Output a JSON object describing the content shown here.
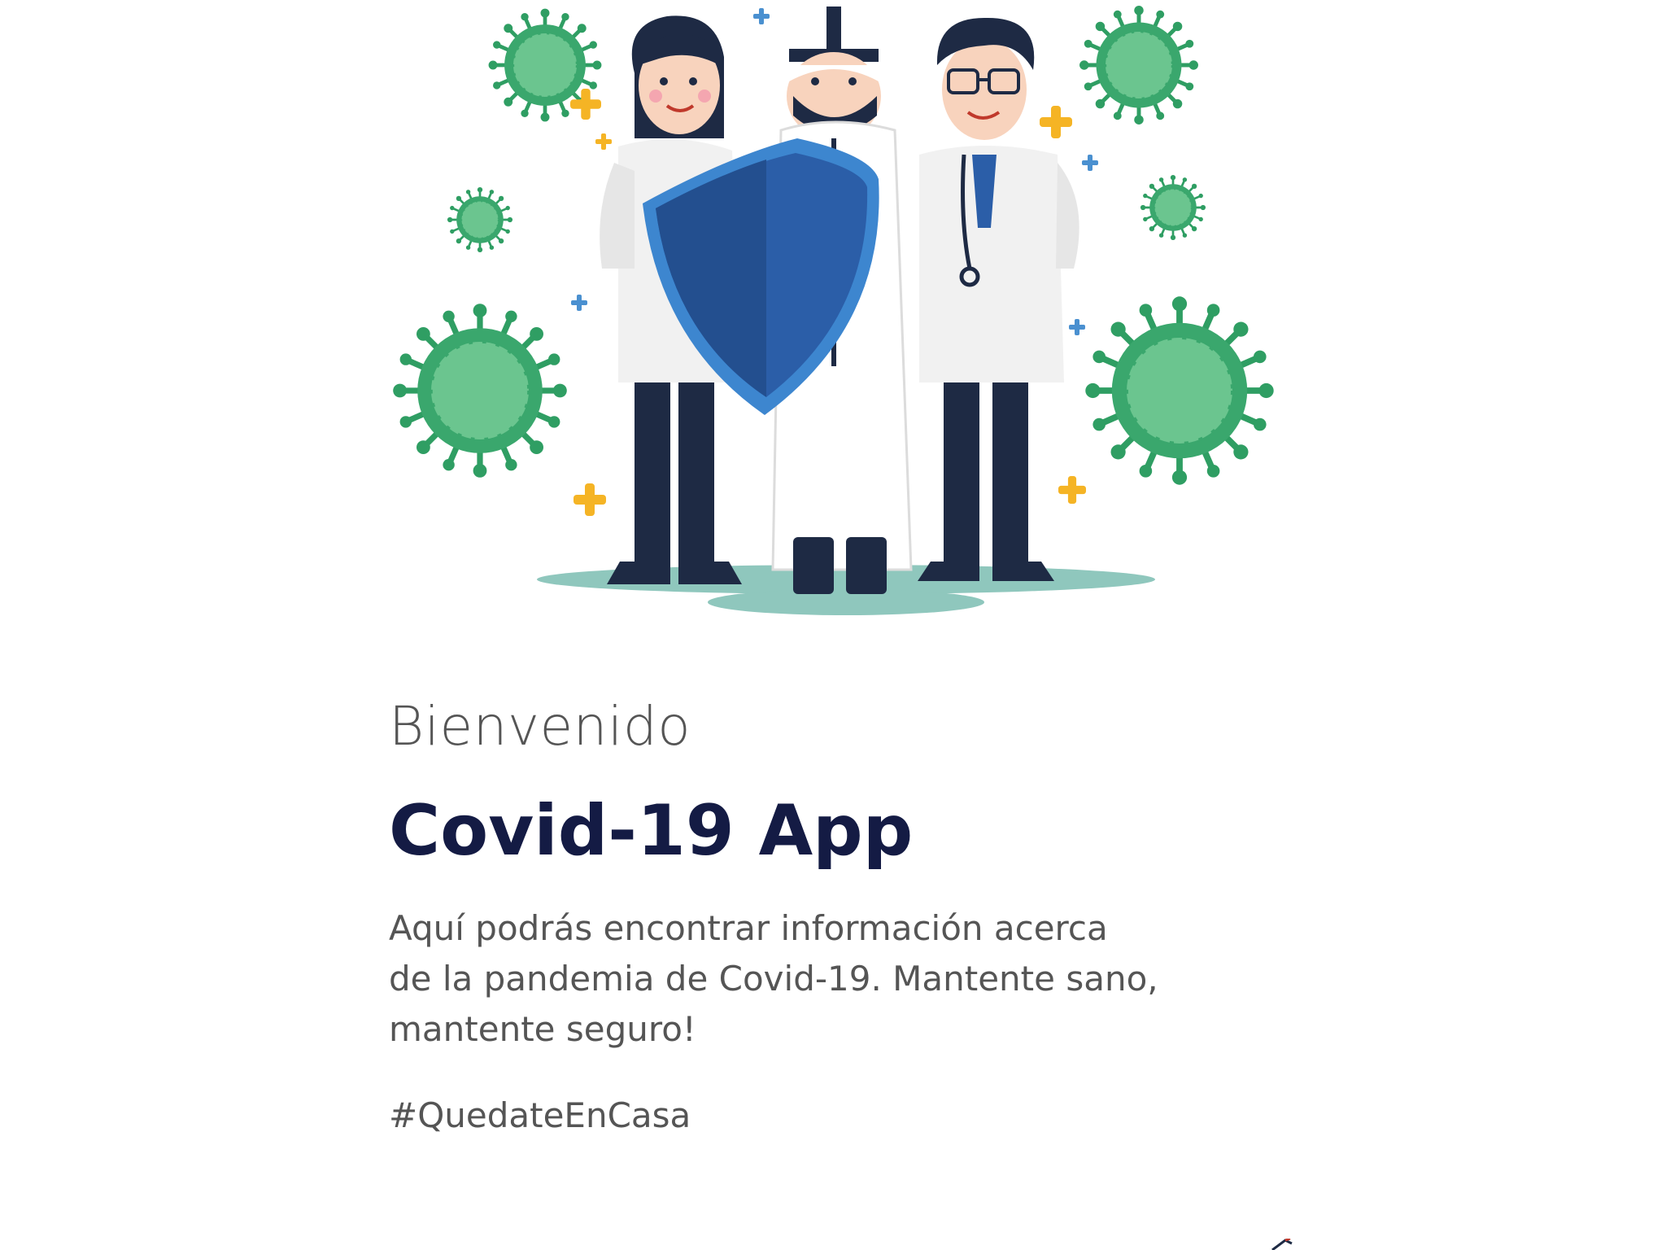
{
  "welcome": {
    "greeting": "Bienvenido",
    "app_title": "Covid-19 App",
    "description": "Aquí podrás encontrar información acerca\nde la pandemia de Covid-19. Mantente sano,\nmantente seguro!",
    "hashtag": "#QuedateEnCasa"
  },
  "illustration": {
    "icon": "medical-team-illustration",
    "colors": {
      "virus": "#3aa76d",
      "virus_light": "#6bc58f",
      "shield": "#2b5ea8",
      "shield_rim": "#3d86cf",
      "navy": "#1e2a44",
      "coat": "#f1f1f1",
      "plus_yellow": "#f5b425",
      "plus_blue": "#4a90d0",
      "ground": "#8fc7bd"
    }
  },
  "colors": {
    "title": "#141b44",
    "text": "#555555",
    "background": "#ffffff"
  }
}
